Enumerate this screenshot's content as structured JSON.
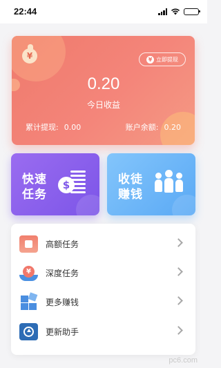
{
  "status_bar": {
    "time": "22:44"
  },
  "earnings_card": {
    "withdraw_button_label": "立即提现",
    "currency_symbol": "¥",
    "amount": "0.20",
    "amount_label": "今日收益",
    "total_withdrawn_label": "累计提现:",
    "total_withdrawn_value": "0.00",
    "balance_label": "账户余额:",
    "balance_value": "0.20",
    "colors": {
      "gradient_start": "#ef7a6c",
      "gradient_end": "#f59a84"
    }
  },
  "tiles": [
    {
      "line1": "快速",
      "line2": "任务",
      "icon": "dollar-list-icon",
      "color": "#7c55e8"
    },
    {
      "line1": "收徒",
      "line2": "赚钱",
      "icon": "people-group-icon",
      "color": "#5aa9f5"
    }
  ],
  "menu": [
    {
      "label": "高额任务",
      "icon": "calendar-icon"
    },
    {
      "label": "深度任务",
      "icon": "hand-coin-icon"
    },
    {
      "label": "更多赚钱",
      "icon": "grid-blocks-icon"
    },
    {
      "label": "更新助手",
      "icon": "update-icon"
    }
  ],
  "watermark": "pc6.com"
}
